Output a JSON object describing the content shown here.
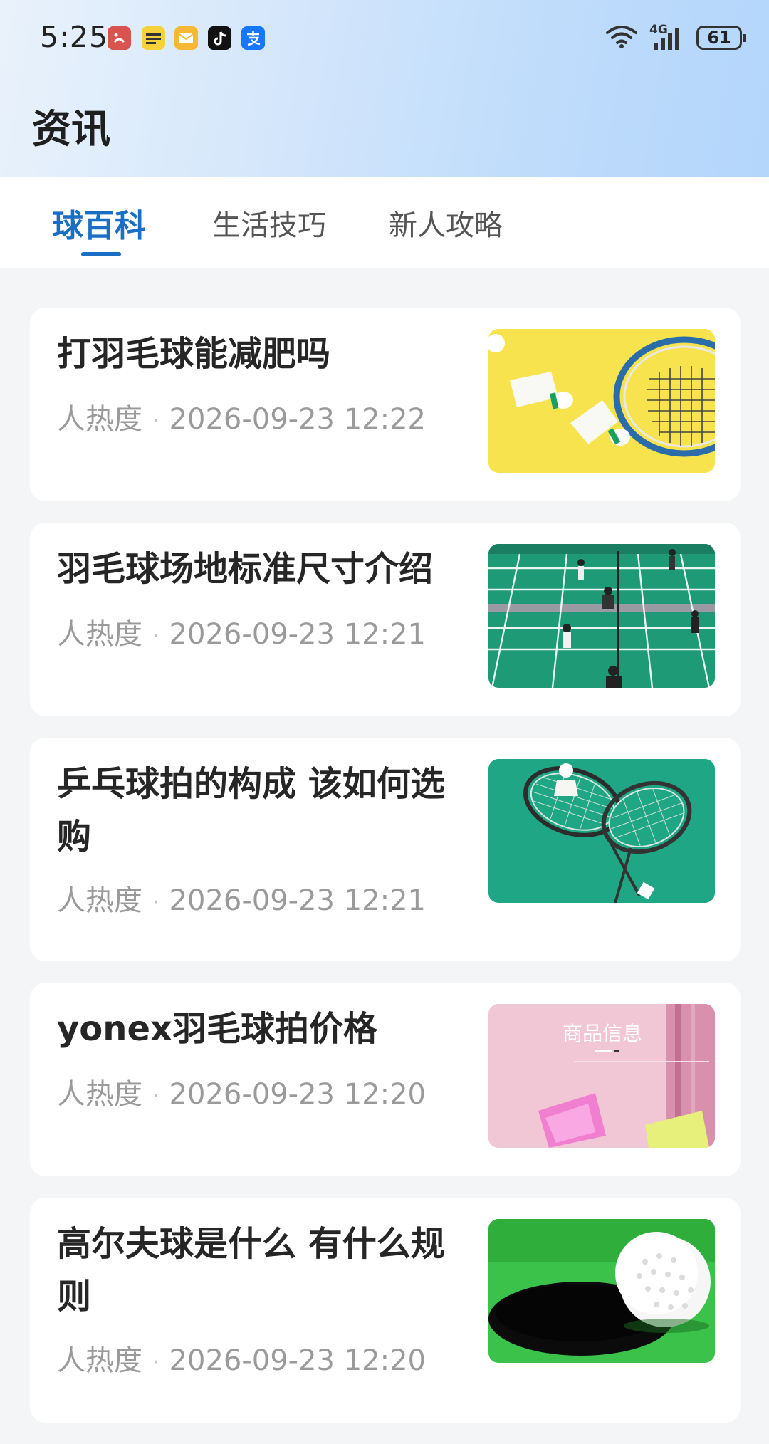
{
  "status_bar": {
    "time": "5:25",
    "network": "4G",
    "battery": "61",
    "icons": [
      "weibo-icon",
      "news-icon",
      "mail-icon",
      "tiktok-icon",
      "alipay-icon",
      "wifi-icon",
      "signal-icon",
      "battery-icon"
    ]
  },
  "header": {
    "title": "资讯"
  },
  "tabs": [
    {
      "label": "球百科",
      "active": true
    },
    {
      "label": "生活技巧",
      "active": false
    },
    {
      "label": "新人攻略",
      "active": false
    }
  ],
  "articles": [
    {
      "title": "打羽毛球能减肥吗",
      "heat": "人热度",
      "date": "2026-09-23 12:22",
      "thumb": "shuttlecocks-on-yellow"
    },
    {
      "title": "羽毛球场地标准尺寸介绍",
      "heat": "人热度",
      "date": "2026-09-23 12:21",
      "thumb": "badminton-court"
    },
    {
      "title": "乒乓球拍的构成 该如何选购",
      "heat": "人热度",
      "date": "2026-09-23 12:21",
      "thumb": "rackets-on-green"
    },
    {
      "title": "yonex羽毛球拍价格",
      "heat": "人热度",
      "date": "2026-09-23 12:20",
      "thumb": "product-info",
      "thumb_text": "商品信息"
    },
    {
      "title": "高尔夫球是什么 有什么规则",
      "heat": "人热度",
      "date": "2026-09-23 12:20",
      "thumb": "golf-ball-hole"
    }
  ]
}
